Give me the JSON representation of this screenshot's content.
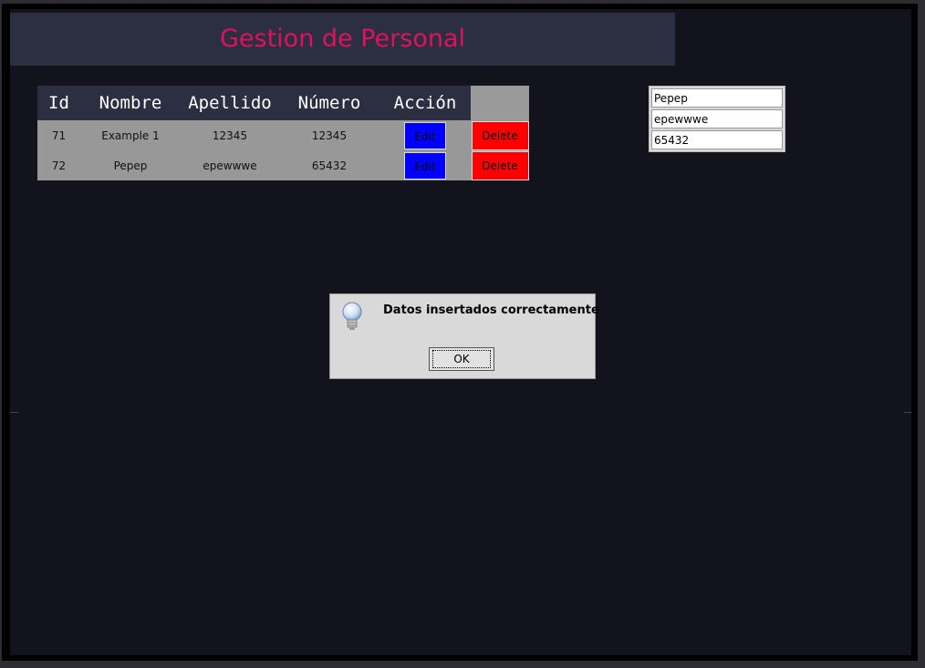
{
  "header": {
    "title": "Gestion de Personal"
  },
  "table": {
    "columns": [
      "Id",
      "Nombre",
      "Apellido",
      "Número",
      "Acción"
    ],
    "rows": [
      {
        "id": "71",
        "nombre": "Example 1",
        "apellido": "12345",
        "numero": "12345",
        "edit_label": "Edit",
        "delete_label": "Delete"
      },
      {
        "id": "72",
        "nombre": "Pepep",
        "apellido": "epewwwe",
        "numero": "65432",
        "edit_label": "Edit",
        "delete_label": "Delete"
      }
    ]
  },
  "form": {
    "nombre_value": "Pepep",
    "apellido_value": "epewwwe",
    "numero_value": "65432"
  },
  "dialog": {
    "message": "Datos insertados correctamente",
    "ok_label": "OK",
    "icon": "lightbulb-icon"
  },
  "colors": {
    "background": "#12131c",
    "header_bg": "#2c2e42",
    "title": "#e0115f",
    "edit": "#0000ff",
    "delete": "#ff0000"
  }
}
